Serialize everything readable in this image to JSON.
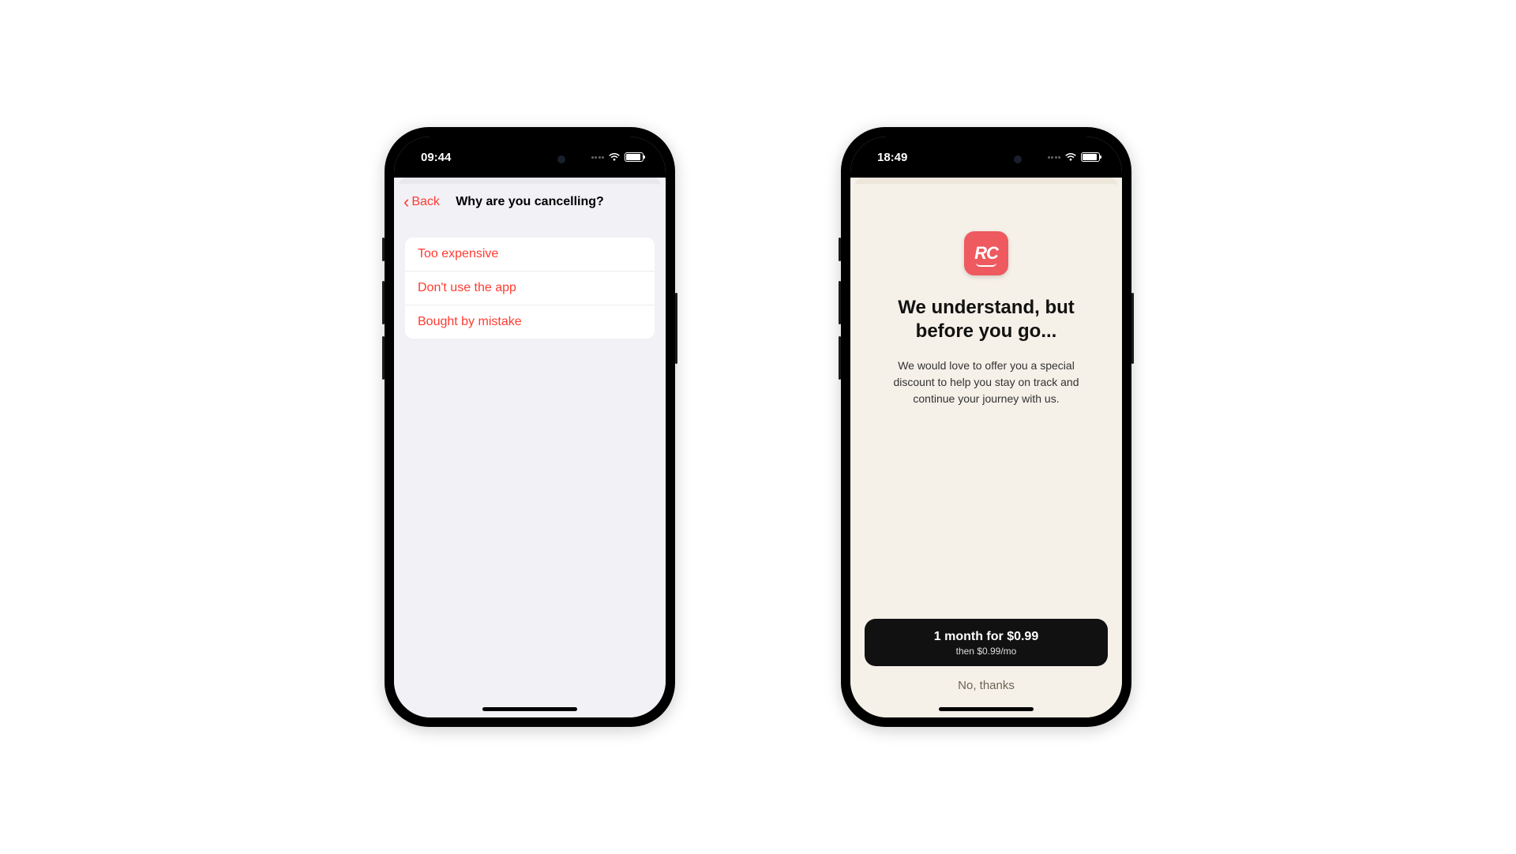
{
  "phone_a": {
    "status": {
      "time": "09:44"
    },
    "nav": {
      "back_label": "Back",
      "title": "Why are you cancelling?"
    },
    "options": [
      "Too expensive",
      "Don't use the app",
      "Bought by mistake"
    ]
  },
  "phone_b": {
    "status": {
      "time": "18:49"
    },
    "app_icon_text": "RC",
    "heading": "We understand, but before you go...",
    "body": "We would love to offer you a special discount to help you stay on track and continue your journey with us.",
    "primary_button": {
      "line1": "1 month for $0.99",
      "line2": "then $0.99/mo"
    },
    "secondary_button": "No, thanks"
  },
  "colors": {
    "ios_red": "#ff3b30",
    "app_icon_bg": "#ee5a5f",
    "offer_bg": "#f5f0e8",
    "list_bg": "#f2f1f6"
  }
}
